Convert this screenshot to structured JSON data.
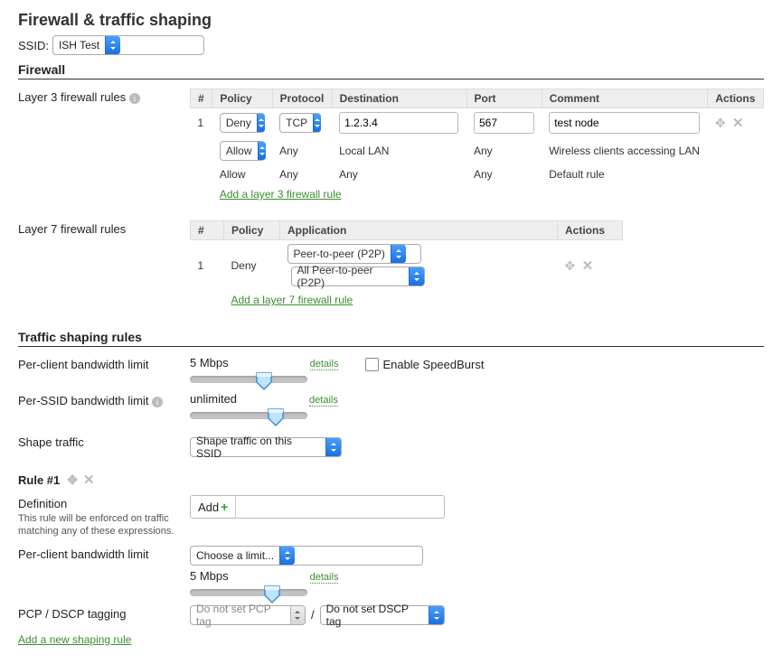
{
  "page_title": "Firewall & traffic shaping",
  "ssid_label": "SSID:",
  "ssid_value": "ISH Test",
  "sections": {
    "firewall": "Firewall",
    "traffic": "Traffic shaping rules"
  },
  "l3": {
    "label": "Layer 3 firewall rules",
    "cols": {
      "num": "#",
      "policy": "Policy",
      "proto": "Protocol",
      "dest": "Destination",
      "port": "Port",
      "comment": "Comment",
      "actions": "Actions"
    },
    "rows": [
      {
        "num": "1",
        "policy": "Deny",
        "proto": "TCP",
        "dest": "1.2.3.4",
        "port": "567",
        "comment": "test node",
        "editable": true
      },
      {
        "policy": "Allow",
        "proto": "Any",
        "dest": "Local LAN",
        "port": "Any",
        "comment": "Wireless clients accessing LAN",
        "policy_select": true
      },
      {
        "policy": "Allow",
        "proto": "Any",
        "dest": "Any",
        "port": "Any",
        "comment": "Default rule"
      }
    ],
    "add": "Add a layer 3 firewall rule"
  },
  "l7": {
    "label": "Layer 7 firewall rules",
    "cols": {
      "num": "#",
      "policy": "Policy",
      "app": "Application",
      "actions": "Actions"
    },
    "rows": [
      {
        "num": "1",
        "policy": "Deny",
        "app": "Peer-to-peer (P2P)",
        "app2": "All Peer-to-peer (P2P)"
      }
    ],
    "add": "Add a layer 7 firewall rule"
  },
  "bw": {
    "per_client_label": "Per-client bandwidth limit",
    "per_client_value": "5 Mbps",
    "per_client_handle_pct": 55,
    "details": "details",
    "speedburst": "Enable SpeedBurst",
    "per_ssid_label": "Per-SSID bandwidth limit",
    "per_ssid_value": "unlimited",
    "per_ssid_handle_pct": 65
  },
  "shape": {
    "label": "Shape traffic",
    "value": "Shape traffic on this SSID"
  },
  "rule": {
    "title": "Rule #1",
    "definition_label": "Definition",
    "definition_sub": "This rule will be enforced on traffic matching any of these expressions.",
    "add": "Add",
    "per_client_label": "Per-client bandwidth limit",
    "limit_select": "Choose a limit...",
    "value": "5 Mbps",
    "handle_pct": 62,
    "pcp_label": "PCP / DSCP tagging",
    "pcp_value": "Do not set PCP tag",
    "dscp_value": "Do not set DSCP tag",
    "sep": "/"
  },
  "add_shaping": "Add a new shaping rule"
}
